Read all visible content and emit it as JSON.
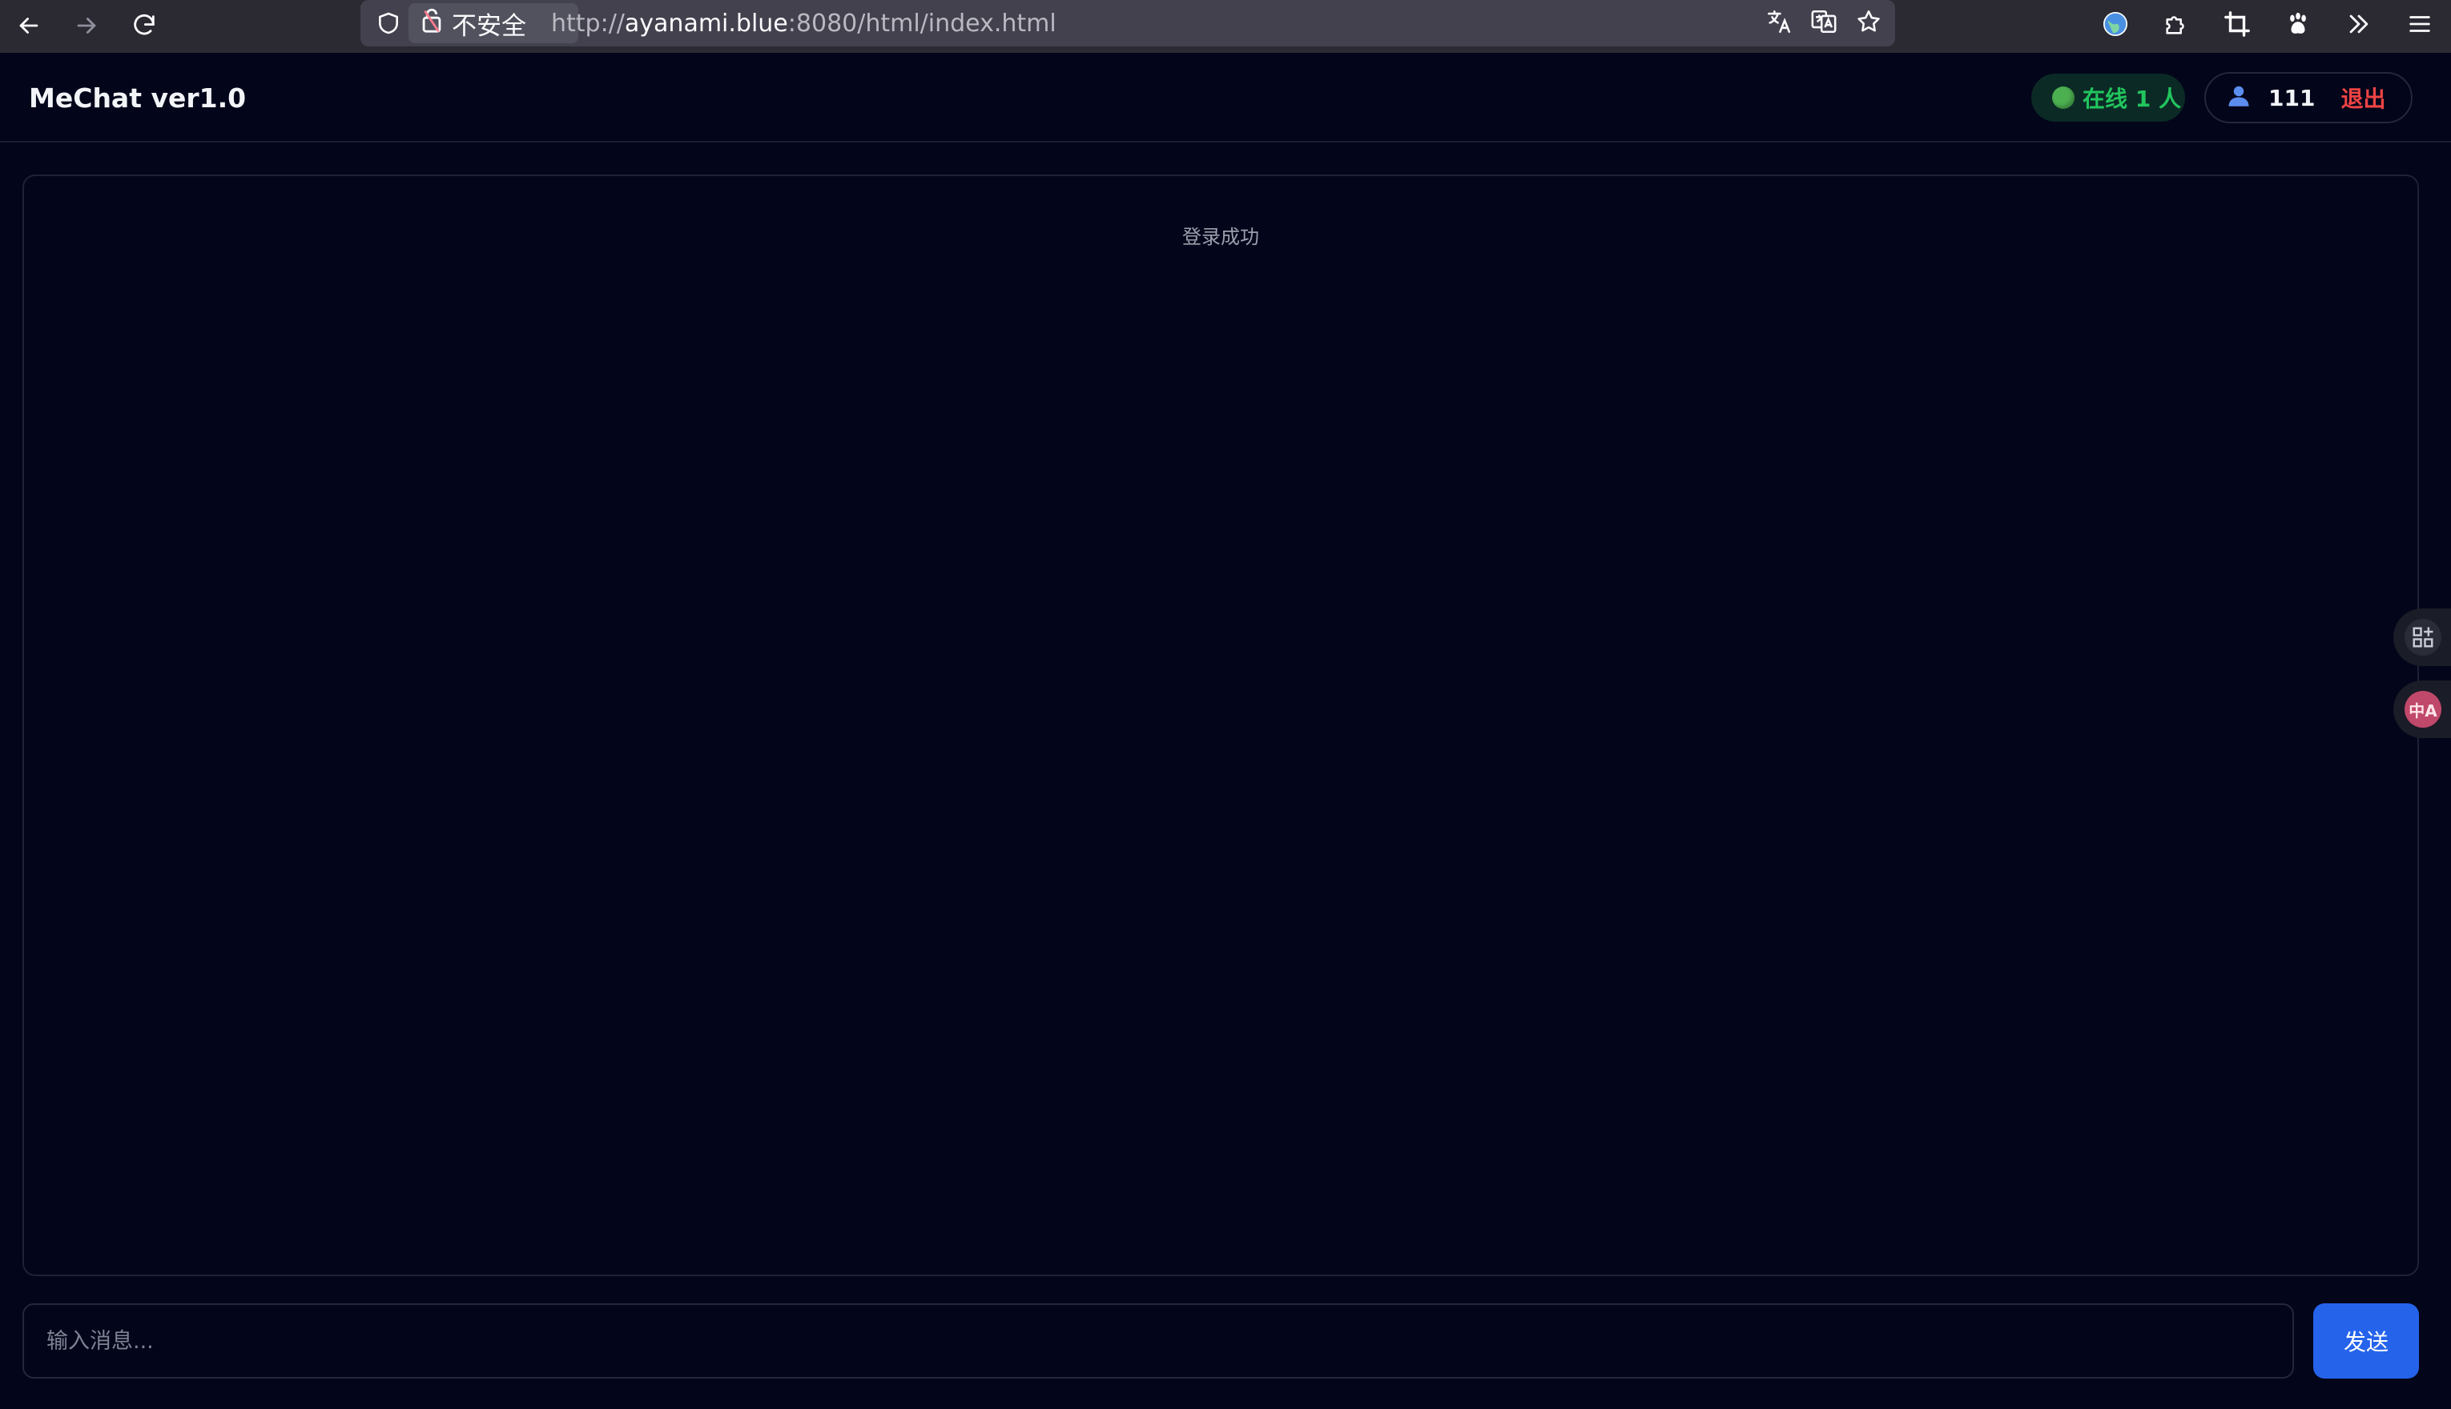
{
  "browser": {
    "insecure_label": "不安全",
    "url_prefix": "http://",
    "url_host": "ayanami.blue",
    "url_rest": ":8080/html/index.html",
    "icons": [
      "back-icon",
      "forward-icon",
      "reload-icon",
      "shield-icon",
      "lock-warning-icon",
      "translate-icon",
      "page-translate-icon",
      "star-icon",
      "globe-extension-icon",
      "extensions-icon",
      "crop-icon",
      "paw-icon",
      "overflow-icon",
      "menu-icon"
    ]
  },
  "app": {
    "title": "MeChat ver1.0",
    "online_text": "在线 1 人",
    "user_name": "111",
    "logout_label": "退出"
  },
  "messages": {
    "system_text": "登录成功"
  },
  "composer": {
    "placeholder": "输入消息...",
    "send_label": "发送"
  },
  "side_widgets": {
    "translate_glyph": "中A"
  },
  "colors": {
    "background": "#03051a",
    "online_green": "#22c55e",
    "logout_red": "#ef4444",
    "send_blue": "#2563eb"
  }
}
